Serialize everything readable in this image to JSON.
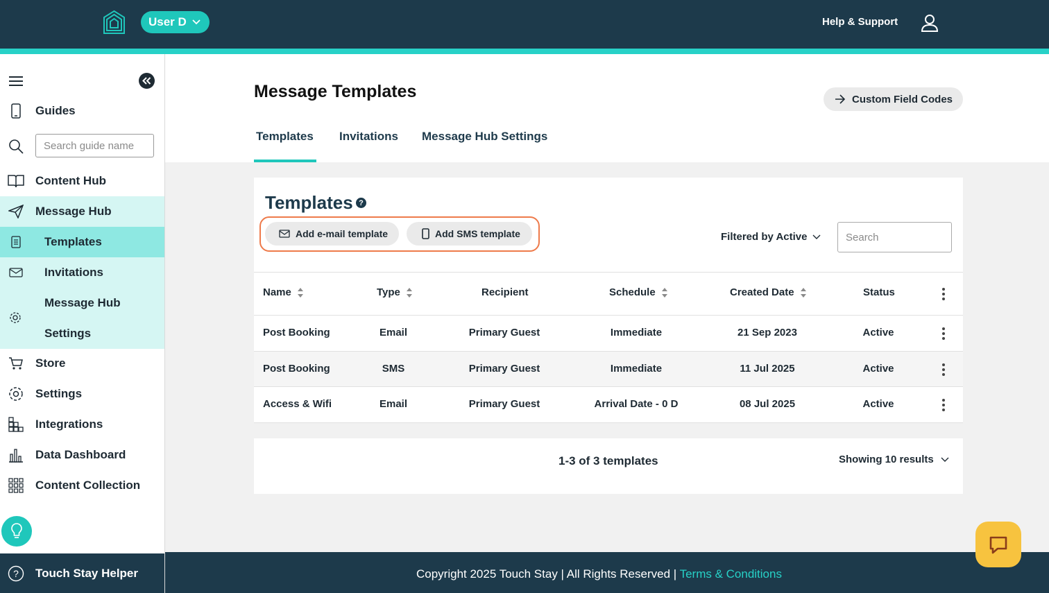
{
  "header": {
    "user_label": "User D",
    "help_label": "Help & Support"
  },
  "sidebar": {
    "guides_label": "Guides",
    "search_placeholder": "Search guide name",
    "content_hub_label": "Content Hub",
    "message_hub_label": "Message Hub",
    "sub_items": [
      "Templates",
      "Invitations",
      "Message Hub",
      "Settings"
    ],
    "store_label": "Store",
    "settings_label": "Settings",
    "integrations_label": "Integrations",
    "data_dashboard_label": "Data Dashboard",
    "content_collection_label": "Content Collection",
    "helper_label": "Touch Stay Helper"
  },
  "page": {
    "title": "Message Templates",
    "custom_field_codes_label": "Custom Field Codes",
    "tabs": [
      "Templates",
      "Invitations",
      "Message Hub Settings"
    ]
  },
  "templates_card": {
    "title": "Templates",
    "help_glyph": "?",
    "add_email_label": "Add e-mail template",
    "add_sms_label": "Add SMS template",
    "filter_label": "Filtered by Active",
    "search_placeholder": "Search",
    "columns": [
      "Name",
      "Type",
      "Recipient",
      "Schedule",
      "Created Date",
      "Status"
    ],
    "rows": [
      {
        "name": "Post Booking",
        "type": "Email",
        "recipient": "Primary Guest",
        "schedule": "Immediate",
        "created": "21 Sep 2023",
        "status": "Active"
      },
      {
        "name": "Post Booking",
        "type": "SMS",
        "recipient": "Primary Guest",
        "schedule": "Immediate",
        "created": "11 Jul 2025",
        "status": "Active"
      },
      {
        "name": "Access & Wifi",
        "type": "Email",
        "recipient": "Primary Guest",
        "schedule": "Arrival Date - 0 D",
        "created": "08 Jul 2025",
        "status": "Active"
      }
    ]
  },
  "pagination": {
    "count_label": "1-3 of 3 templates",
    "page_size_label": "Showing 10 results"
  },
  "footer": {
    "copyright": "Copyright 2025 Touch Stay | All Rights Reserved | ",
    "terms_label": "Terms & Conditions"
  },
  "colors": {
    "brand_dark": "#1d3a4b",
    "brand_teal": "#1fc7bb",
    "highlight_orange": "#ee7a4a",
    "chat_yellow": "#f7c33f"
  }
}
